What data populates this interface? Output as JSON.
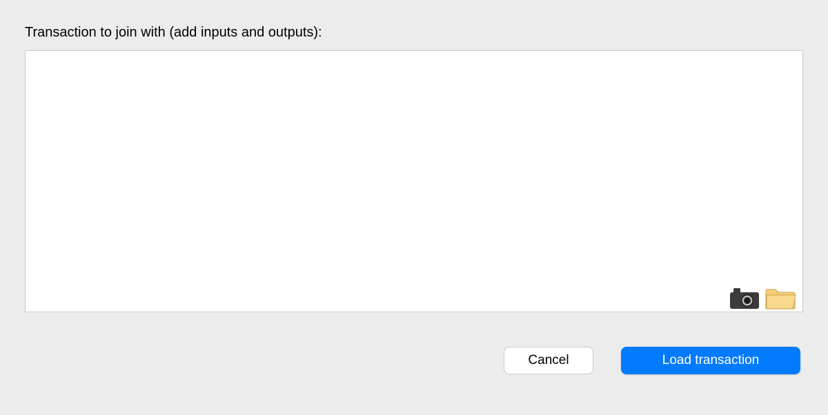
{
  "label": "Transaction to join with (add inputs and outputs):",
  "textarea": {
    "value": "",
    "placeholder": ""
  },
  "icons": {
    "camera": "camera-icon",
    "folder": "folder-icon"
  },
  "buttons": {
    "cancel": "Cancel",
    "load": "Load transaction"
  },
  "colors": {
    "background": "#ececec",
    "primary": "#007aff",
    "border": "#c9c9c9"
  }
}
